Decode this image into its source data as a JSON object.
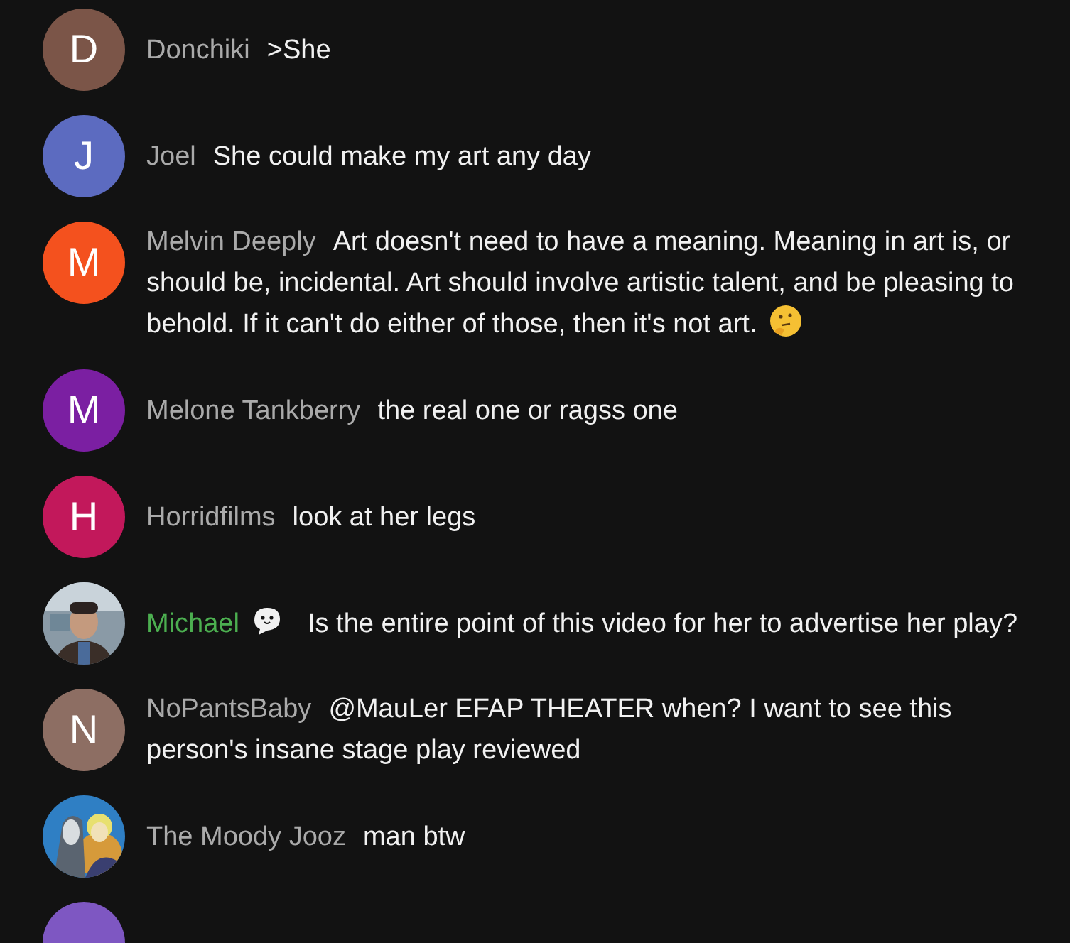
{
  "messages": [
    {
      "avatar": {
        "kind": "letter",
        "letter": "D",
        "color": "#7b5548"
      },
      "author": "Donchiki",
      "member": false,
      "badge": false,
      "text": ">She",
      "emoji": false
    },
    {
      "avatar": {
        "kind": "letter",
        "letter": "J",
        "color": "#5c6bc0"
      },
      "author": "Joel",
      "member": false,
      "badge": false,
      "text": "She could make my art any day",
      "emoji": false
    },
    {
      "avatar": {
        "kind": "letter",
        "letter": "M",
        "color": "#f4511e"
      },
      "author": "Melvin Deeply",
      "member": false,
      "badge": false,
      "text": "Art doesn't need to have a meaning. Meaning in art is, or should be, incidental. Art should involve artistic talent, and be pleasing to behold. If it can't do either of those, then it's not art.",
      "emoji": true
    },
    {
      "avatar": {
        "kind": "letter",
        "letter": "M",
        "color": "#7b1fa2"
      },
      "author": "Melone Tankberry",
      "member": false,
      "badge": false,
      "text": "the real one or ragss one",
      "emoji": false
    },
    {
      "avatar": {
        "kind": "letter",
        "letter": "H",
        "color": "#c2185b"
      },
      "author": "Horridfilms",
      "member": false,
      "badge": false,
      "text": "look at her legs",
      "emoji": false
    },
    {
      "author": "Michael",
      "member": true,
      "badge": true,
      "text": "Is the entire point of this video for her to advertise her play?",
      "emoji": false
    },
    {
      "avatar": {
        "kind": "letter",
        "letter": "N",
        "color": "#8d6e63"
      },
      "author": "NoPantsBaby",
      "member": false,
      "badge": false,
      "text": "@MauLer EFAP THEATER when? I want to see this person's insane stage play reviewed",
      "emoji": false
    },
    {
      "author": "The Moody Jooz",
      "member": false,
      "badge": false,
      "text": "man btw",
      "emoji": false
    },
    {
      "avatar": {
        "kind": "letter",
        "color": "#7e57c2"
      }
    }
  ]
}
